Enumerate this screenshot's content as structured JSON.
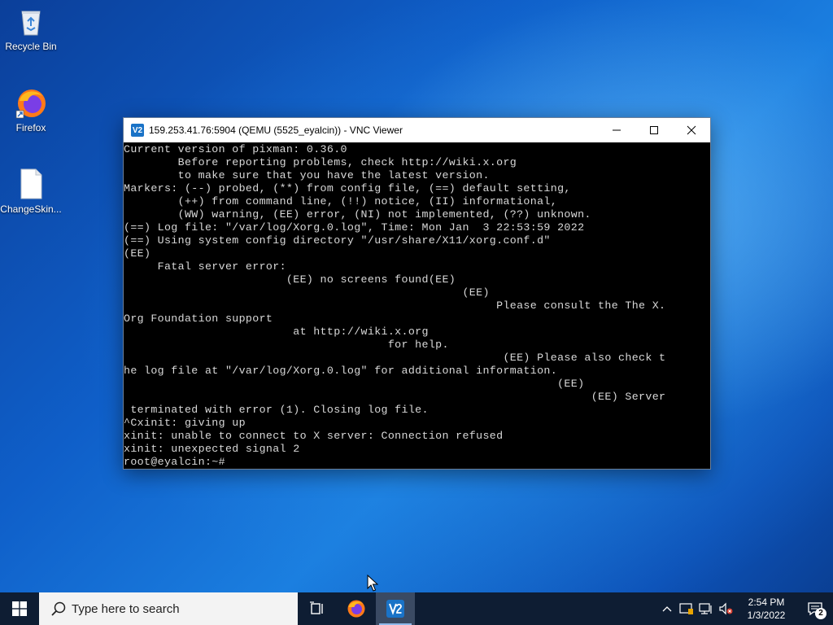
{
  "desktop": {
    "icons": [
      {
        "label": "Recycle Bin"
      },
      {
        "label": "Firefox"
      },
      {
        "label": "ChangeSkin..."
      }
    ]
  },
  "vnc_window": {
    "title": "159.253.41.76:5904 (QEMU (5525_eyalcin)) - VNC Viewer",
    "app_icon_text": "V2",
    "terminal_lines": [
      "Current version of pixman: 0.36.0",
      "        Before reporting problems, check http://wiki.x.org",
      "        to make sure that you have the latest version.",
      "Markers: (--) probed, (**) from config file, (==) default setting,",
      "        (++) from command line, (!!) notice, (II) informational,",
      "        (WW) warning, (EE) error, (NI) not implemented, (??) unknown.",
      "(==) Log file: \"/var/log/Xorg.0.log\", Time: Mon Jan  3 22:53:59 2022",
      "(==) Using system config directory \"/usr/share/X11/xorg.conf.d\"",
      "(EE)",
      "     Fatal server error:",
      "                        (EE) no screens found(EE)",
      "                                                  (EE)",
      "                                                       Please consult the The X.",
      "Org Foundation support",
      "                         at http://wiki.x.org",
      "                                       for help.",
      "                                                        (EE) Please also check t",
      "he log file at \"/var/log/Xorg.0.log\" for additional information.",
      "                                                                (EE)",
      "                                                                     (EE) Server",
      " terminated with error (1). Closing log file.",
      "^Cxinit: giving up",
      "xinit: unable to connect to X server: Connection refused",
      "xinit: unexpected signal 2",
      "root@eyalcin:~#"
    ]
  },
  "taskbar": {
    "search_placeholder": "Type here to search",
    "clock_time": "2:54 PM",
    "clock_date": "1/3/2022",
    "notification_count": "2"
  }
}
